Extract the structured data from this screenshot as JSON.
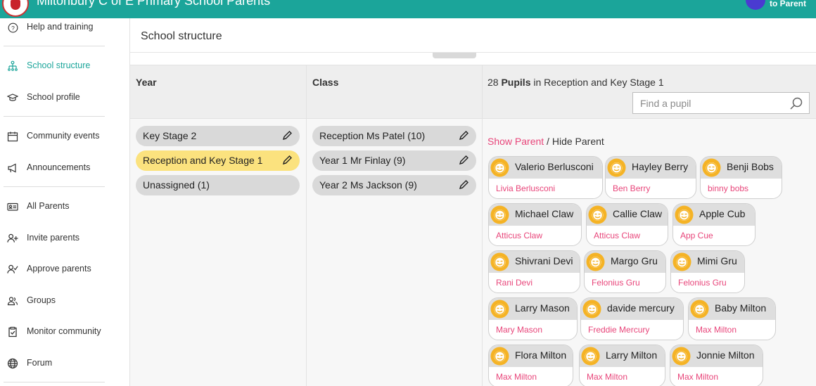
{
  "header": {
    "title": "Miltonbury C of E Primary School Parents",
    "switch_label": "to Parent"
  },
  "sidebar": {
    "items": [
      {
        "label": "Help and training",
        "icon": "help-circle-icon"
      },
      {
        "label": "School structure",
        "icon": "hierarchy-icon",
        "active": true
      },
      {
        "label": "School profile",
        "icon": "graduation-cap-icon"
      },
      {
        "label": "Community events",
        "icon": "calendar-icon"
      },
      {
        "label": "Announcements",
        "icon": "megaphone-icon"
      },
      {
        "label": "All Parents",
        "icon": "id-card-icon"
      },
      {
        "label": "Invite parents",
        "icon": "user-plus-icon"
      },
      {
        "label": "Approve parents",
        "icon": "user-check-icon"
      },
      {
        "label": "Groups",
        "icon": "users-icon"
      },
      {
        "label": "Monitor community",
        "icon": "clipboard-check-icon"
      },
      {
        "label": "Forum",
        "icon": "globe-icon"
      }
    ]
  },
  "main": {
    "title": "School structure",
    "year_header": "Year",
    "class_header": "Class",
    "years": [
      {
        "label": "Key Stage 2",
        "selected": false
      },
      {
        "label": "Reception and Key Stage 1",
        "selected": true
      },
      {
        "label": "Unassigned (1)",
        "selected": false
      }
    ],
    "classes": [
      {
        "label": "Reception Ms Patel (10)"
      },
      {
        "label": "Year 1 Mr Finlay (9)"
      },
      {
        "label": "Year 2 Ms Jackson (9)"
      }
    ],
    "pupils_summary": {
      "count": "28",
      "noun": "Pupils",
      "suffix": "in Reception and Key Stage 1"
    },
    "search": {
      "placeholder": "Find a pupil"
    },
    "toggle": {
      "show": "Show Parent",
      "separator": " / ",
      "hide": "Hide Parent"
    },
    "pupils": [
      {
        "name": "Valerio Berlusconi",
        "parent": "Livia Berlusconi"
      },
      {
        "name": "Hayley Berry",
        "parent": "Ben Berry"
      },
      {
        "name": "Benji Bobs",
        "parent": "binny bobs"
      },
      {
        "name": "Michael Claw",
        "parent": "Atticus Claw"
      },
      {
        "name": "Callie Claw",
        "parent": "Atticus Claw"
      },
      {
        "name": "Apple Cub",
        "parent": "App Cue"
      },
      {
        "name": "Shivrani Devi",
        "parent": "Rani Devi"
      },
      {
        "name": "Margo Gru",
        "parent": "Felonius Gru"
      },
      {
        "name": "Mimi Gru",
        "parent": "Felonius Gru"
      },
      {
        "name": "Larry Mason",
        "parent": "Mary Mason"
      },
      {
        "name": "davide mercury",
        "parent": "Freddie Mercury"
      },
      {
        "name": "Baby Milton",
        "parent": "Max Milton"
      },
      {
        "name": "Flora Milton",
        "parent": "Max Milton"
      },
      {
        "name": "Larry Milton",
        "parent": "Max Milton"
      },
      {
        "name": "Jonnie Milton",
        "parent": "Max Milton"
      }
    ]
  },
  "colors": {
    "header_bg": "#1ba59a",
    "active_nav": "#1ba59a",
    "selected_year": "#fbe27e",
    "parent_link": "#e8457a",
    "avatar_face": "#f5b325"
  }
}
